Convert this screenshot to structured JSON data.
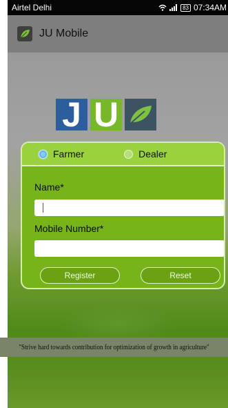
{
  "status_bar": {
    "carrier": "Airtel Delhi",
    "battery": "83",
    "time": "07:34AM"
  },
  "action_bar": {
    "title": "JU Mobile",
    "icon": "leaf-icon"
  },
  "logo": {
    "letter1": "J",
    "letter2": "U",
    "icon": "leaf-icon"
  },
  "form": {
    "radio_options": [
      {
        "label": "Farmer",
        "selected": true
      },
      {
        "label": "Dealer",
        "selected": false
      }
    ],
    "name_label": "Name*",
    "name_value": "",
    "mobile_label": "Mobile Number*",
    "mobile_value": "",
    "register_label": "Register",
    "reset_label": "Reset"
  },
  "tagline": "\"Strive hard towards contribution for optimization of growth in agriculture\"",
  "colors": {
    "card_green": "#77b41a",
    "radio_row_green": "#9ad13f",
    "logo_blue": "#2c5d9c",
    "logo_green": "#76b82a",
    "radio_selected": "#5fb5ec"
  }
}
